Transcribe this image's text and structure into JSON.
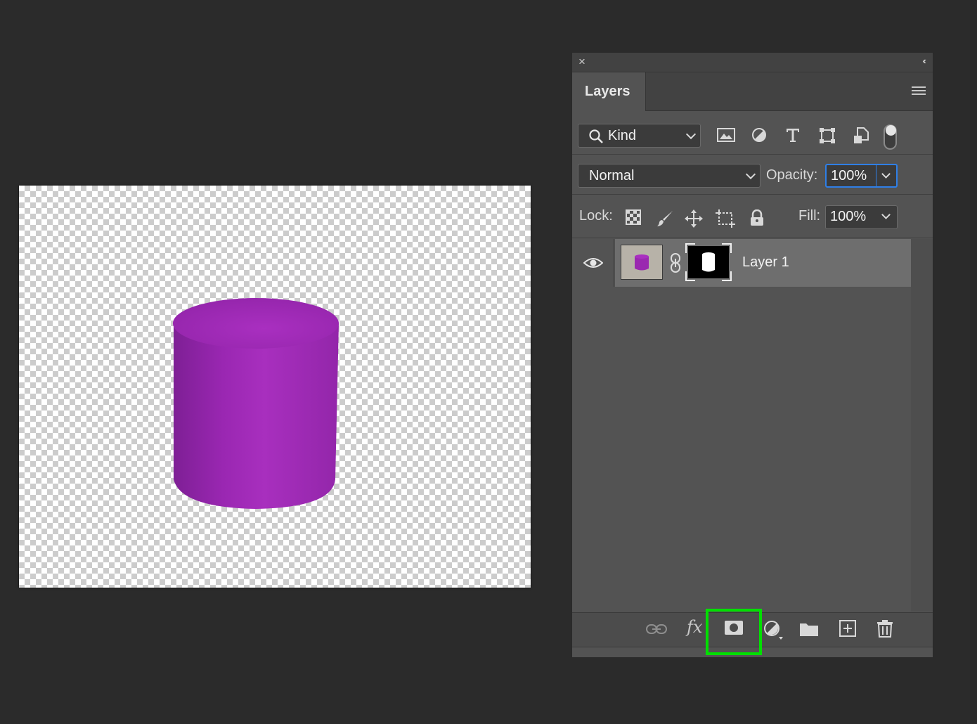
{
  "panel": {
    "close_glyph": "×",
    "collapse_glyph": "‹‹",
    "tab_label": "Layers"
  },
  "filter": {
    "kind_label": "Kind",
    "icons": [
      "image-filter-icon",
      "adjustment-filter-icon",
      "type-filter-icon",
      "shape-filter-icon",
      "smart-object-filter-icon"
    ]
  },
  "blend": {
    "mode": "Normal",
    "opacity_label": "Opacity:",
    "opacity_value": "100%"
  },
  "lock": {
    "label": "Lock:",
    "icons": [
      "lock-transparent-pixels-icon",
      "lock-image-pixels-icon",
      "lock-position-icon",
      "lock-artboard-icon",
      "lock-all-icon"
    ],
    "fill_label": "Fill:",
    "fill_value": "100%"
  },
  "layers": [
    {
      "name": "Layer 1",
      "visible": true,
      "has_mask": true
    }
  ],
  "bottom_toolbar": {
    "fx_label": "fx",
    "highlighted": "add-layer-mask-button",
    "highlight_color": "#00e000"
  },
  "colors": {
    "background": "#2b2b2b",
    "panel": "#535353",
    "cylinder": "#9a28b0",
    "focus_border": "#2f7fe6"
  }
}
